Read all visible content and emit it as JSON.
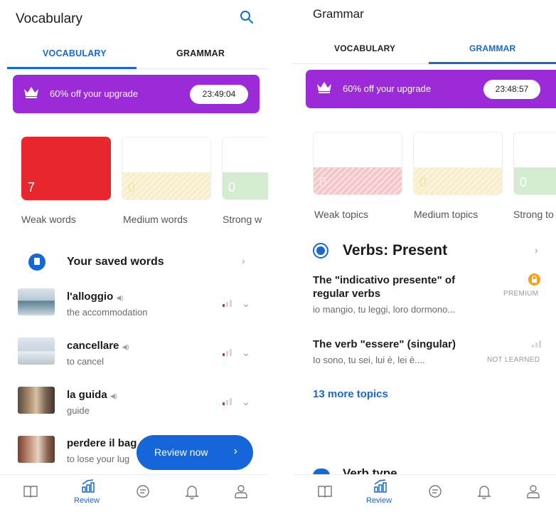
{
  "left": {
    "title": "Vocabulary",
    "tabs": [
      "VOCABULARY",
      "GRAMMAR"
    ],
    "promo": {
      "text": "60% off your upgrade",
      "timer": "23:49:04"
    },
    "cards": [
      {
        "count": "7",
        "label": "Weak words"
      },
      {
        "count": "0",
        "label": "Medium words"
      },
      {
        "count": "0",
        "label": "Strong w"
      }
    ],
    "saved": {
      "label": "Your saved words"
    },
    "words": [
      {
        "word": "l'alloggio",
        "meaning": "the accommodation"
      },
      {
        "word": "cancellare",
        "meaning": "to cancel"
      },
      {
        "word": "la guida",
        "meaning": "guide"
      },
      {
        "word": "perdere il bag",
        "meaning": "to lose your lug"
      }
    ],
    "review_button": "Review now",
    "nav": {
      "active_label": "Review"
    }
  },
  "right": {
    "title": "Grammar",
    "tabs": [
      "VOCABULARY",
      "GRAMMAR"
    ],
    "promo": {
      "text": "60% off your upgrade",
      "timer": "23:48:57"
    },
    "cards": [
      {
        "count": "0",
        "label": "Weak topics"
      },
      {
        "count": "0",
        "label": "Medium topics"
      },
      {
        "count": "0",
        "label": "Strong to"
      }
    ],
    "section": {
      "title": "Verbs: Present"
    },
    "topics": [
      {
        "title_line1": "The \"indicativo presente\" of",
        "title_line2": "regular verbs",
        "sub": "io mangio, tu leggi, loro dormono...",
        "tag": "PREMIUM"
      },
      {
        "title_line1": "The verb \"essere\" (singular)",
        "title_line2": "",
        "sub": "Io sono, tu sei, lui è, lei è....",
        "tag": "NOT LEARNED"
      }
    ],
    "more": "13 more topics",
    "next_section": "Verb type",
    "nav": {
      "active_label": "Review"
    }
  },
  "colors": {
    "accent": "#1668d4",
    "promo": "#9b2bd8",
    "weak": "#e8262e",
    "button": "#1566d8"
  }
}
